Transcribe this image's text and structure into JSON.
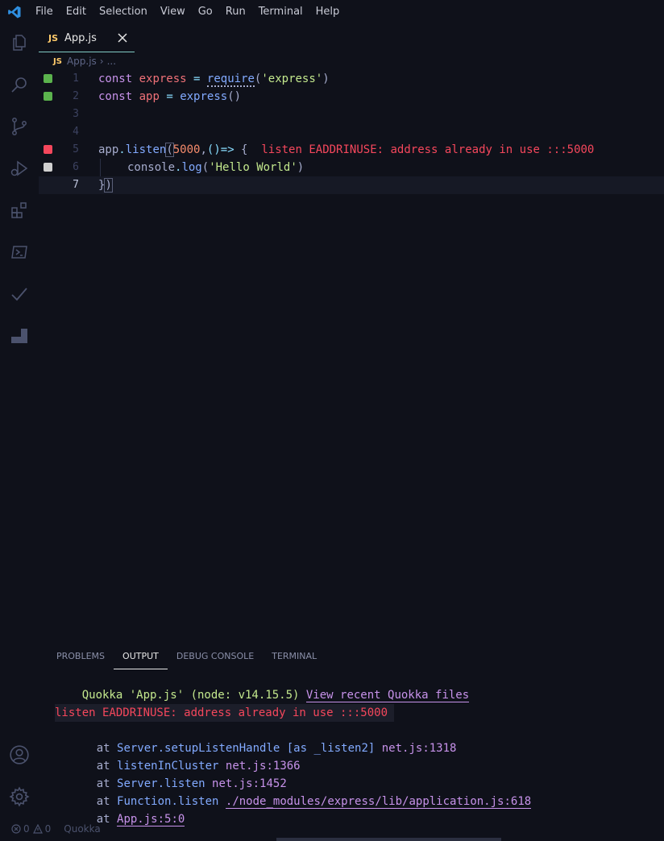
{
  "menu": [
    "File",
    "Edit",
    "Selection",
    "View",
    "Go",
    "Run",
    "Terminal",
    "Help"
  ],
  "tab": {
    "badge": "JS",
    "label": "App.js"
  },
  "breadcrumb": {
    "badge": "JS",
    "file": "App.js",
    "separator": "›",
    "more": "..."
  },
  "editor": {
    "line_numbers": [
      "1",
      "2",
      "3",
      "4",
      "5",
      "6",
      "7"
    ],
    "gutter_colors": {
      "ok": "#5bb34d",
      "error": "#f5475c",
      "neutral": "#d0d0d0"
    },
    "line1": {
      "kw": "const",
      "var": "express",
      "eq": " = ",
      "fn": "require",
      "open": "(",
      "str": "'express'",
      "close": ")"
    },
    "line2": {
      "kw": "const",
      "var": "app",
      "eq": " = ",
      "fn": "express",
      "parens": "()"
    },
    "line5": {
      "obj": "app",
      "dot": ".",
      "fn": "listen",
      "open": "(",
      "num": "5000",
      "comma": ",",
      "arrow": "()=>",
      "brace": " {",
      "inline_error": "listen EADDRINUSE: address already in use :::5000"
    },
    "line6": {
      "obj": "console",
      "dot": ".",
      "fn": "log",
      "open": "(",
      "str": "'Hello World'",
      "close": ")"
    },
    "line7": {
      "brace": "}",
      "paren": ")"
    }
  },
  "panel": {
    "tabs": [
      "PROBLEMS",
      "OUTPUT",
      "DEBUG CONSOLE",
      "TERMINAL"
    ],
    "active_tab": "OUTPUT"
  },
  "output": {
    "header": "Quokka 'App.js' (node: v14.15.5)",
    "header_link": "View recent Quokka files",
    "error": "listen EADDRINUSE: address already in use :::5000",
    "stack": [
      {
        "at": "at",
        "fn": "Server.setupListenHandle [as _listen2]",
        "loc": "net.js:1318"
      },
      {
        "at": "at",
        "fn": "listenInCluster",
        "loc": "net.js:1366"
      },
      {
        "at": "at",
        "fn": "Server.listen",
        "loc": "net.js:1452"
      },
      {
        "at": "at",
        "fn": "Function.listen",
        "loc": "./node_modules/express/lib/application.js:618"
      },
      {
        "at": "at",
        "fn": "",
        "loc": "App.js:5:0"
      }
    ]
  },
  "statusbar": {
    "errors": "0",
    "warnings": "0",
    "quokka": "Quokka"
  }
}
